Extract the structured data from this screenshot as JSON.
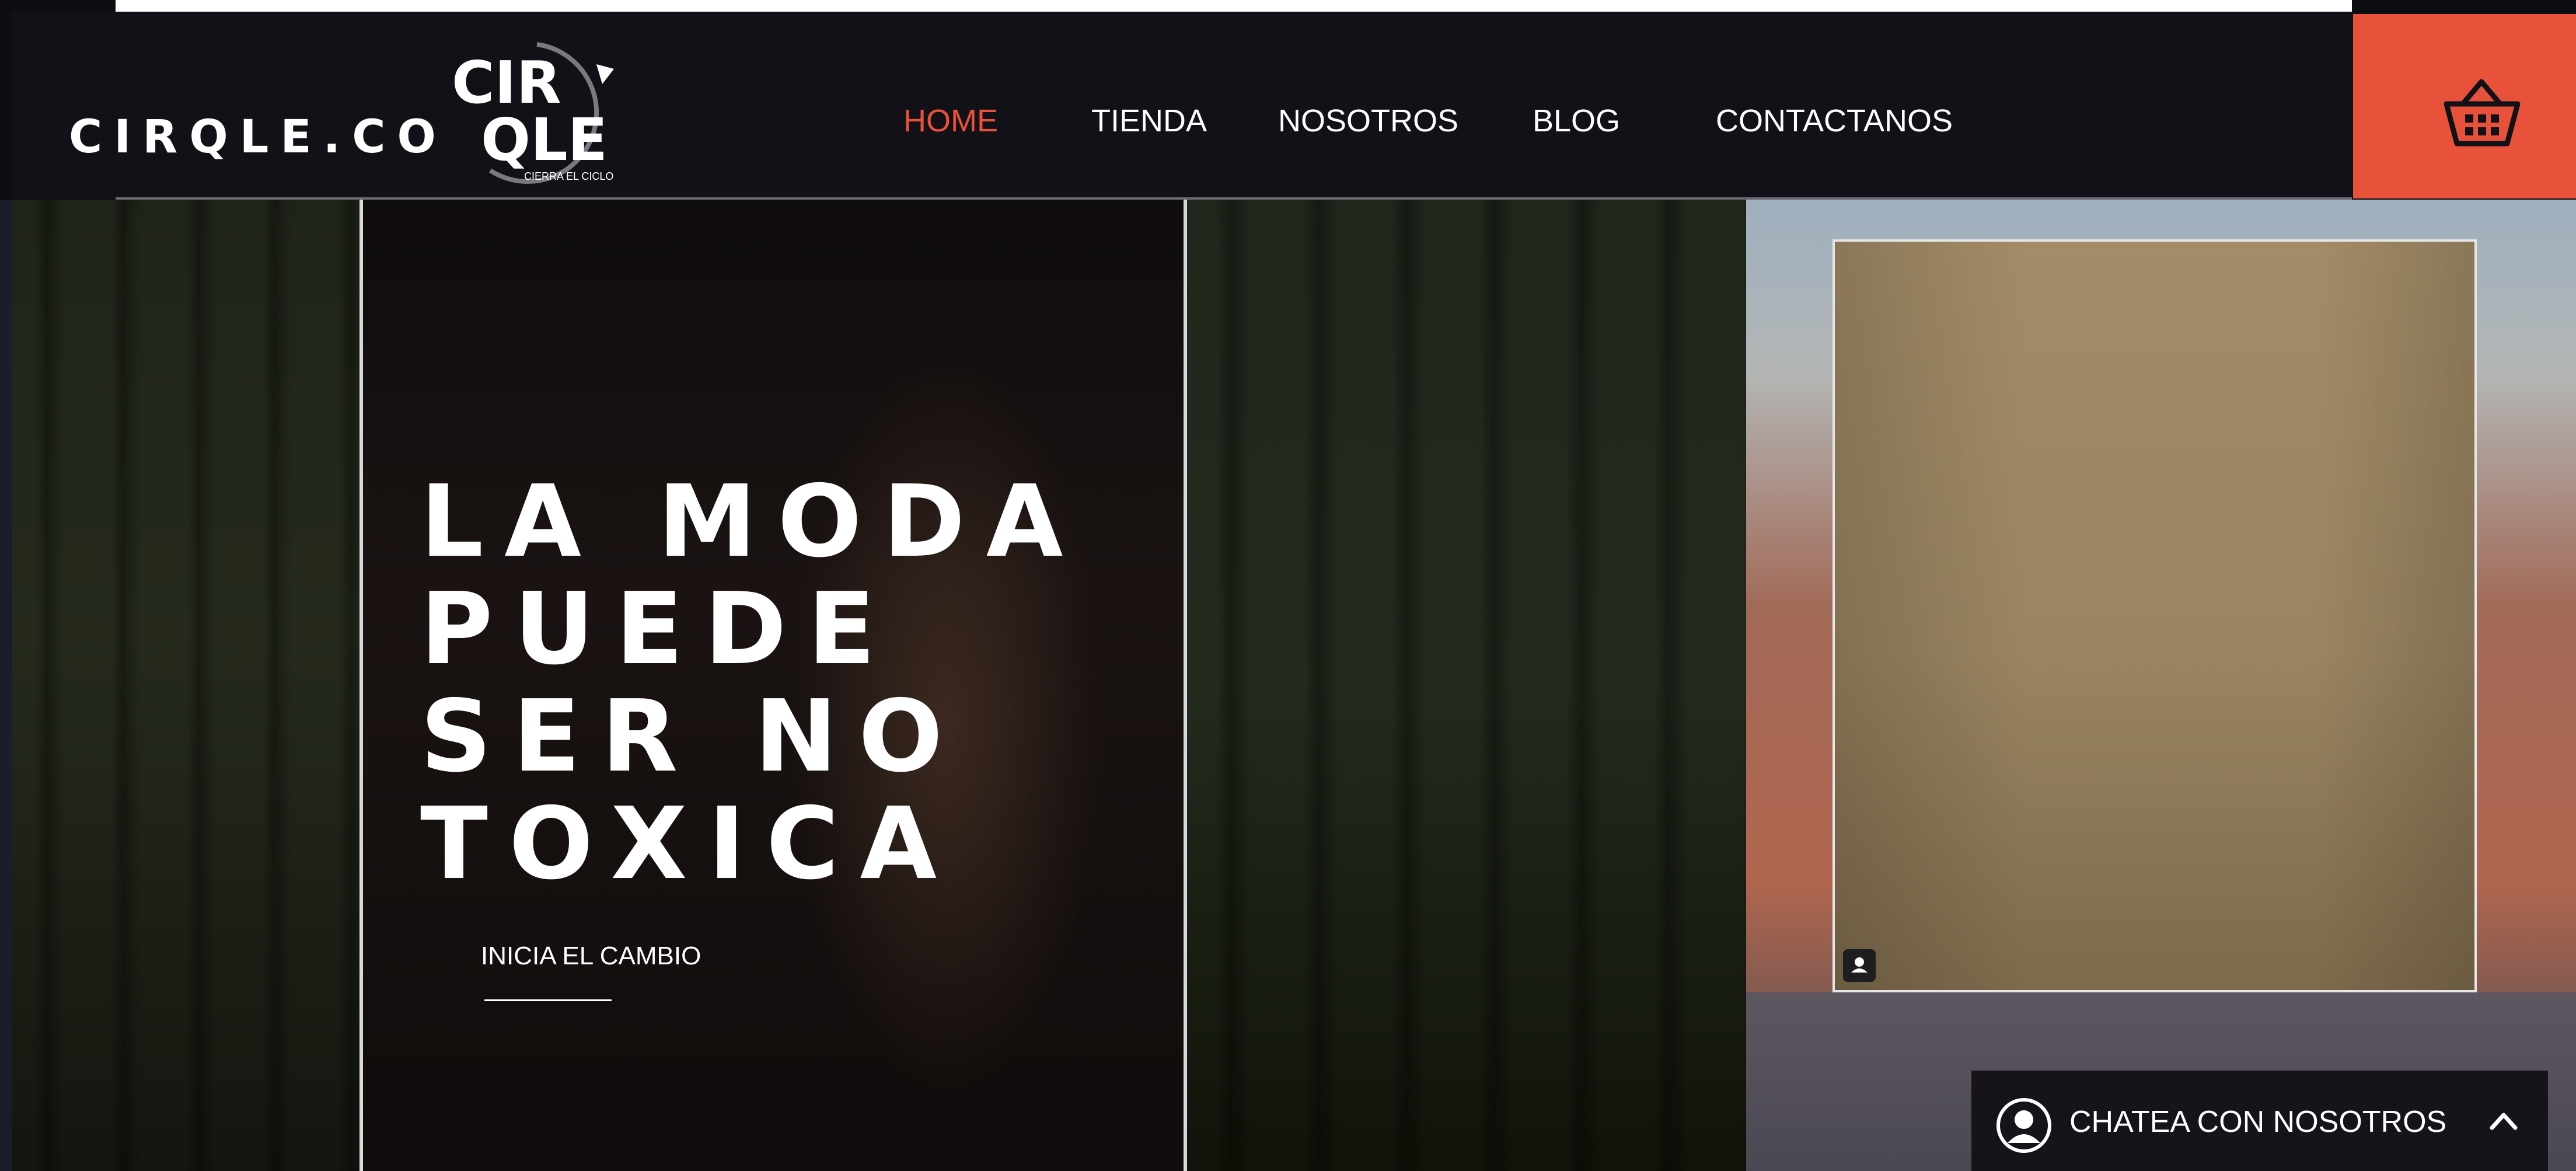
{
  "header": {
    "brand_name": "CIRQLE.CO",
    "logo": {
      "line1": "CIR",
      "line2": "QLE",
      "tagline": "CIERRA EL CICLO"
    },
    "nav": [
      {
        "label": "HOME",
        "active": true
      },
      {
        "label": "TIENDA",
        "active": false
      },
      {
        "label": "NOSOTROS",
        "active": false
      },
      {
        "label": "BLOG",
        "active": false
      },
      {
        "label": "CONTACTANOS",
        "active": false
      }
    ],
    "cart_icon": "shopping-basket-icon"
  },
  "hero": {
    "title_lines": [
      "LA MODA",
      "PUEDE",
      "SER NO",
      "TOXICA"
    ],
    "cta_label": "INICIA EL CAMBIO"
  },
  "photo": {
    "badge_icon": "person-badge-icon"
  },
  "chat": {
    "label": "CHATEA CON NOSOTROS",
    "avatar_icon": "user-avatar-icon",
    "toggle_icon": "chevron-up-icon"
  },
  "colors": {
    "accent": "#e8513a",
    "header_bg": "#131118",
    "text": "#ffffff"
  }
}
